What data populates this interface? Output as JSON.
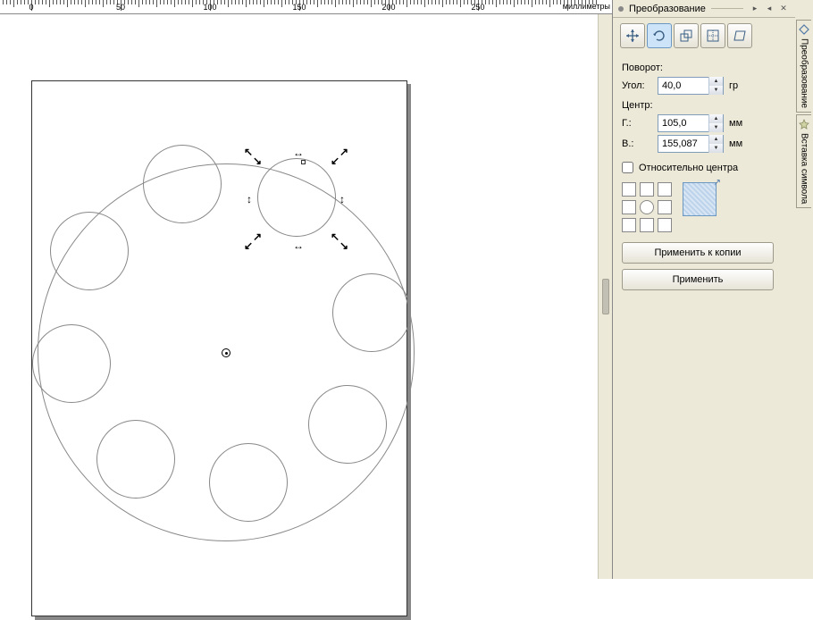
{
  "ruler": {
    "unit_label": "миллиметры",
    "ticks": [
      0,
      50,
      100,
      150,
      200,
      250
    ]
  },
  "panel": {
    "title": "Преобразование",
    "tabs_vertical": [
      {
        "label": "Преобразование",
        "active": true
      },
      {
        "label": "Вставка символа",
        "active": false
      }
    ],
    "transform_tabs": [
      "position",
      "rotate",
      "scale",
      "size",
      "skew"
    ],
    "active_transform_tab": "rotate",
    "rotation": {
      "label": "Поворот:",
      "angle": {
        "label": "Угол:",
        "value": "40,0",
        "unit": "гр"
      }
    },
    "center": {
      "label": "Центр:",
      "h": {
        "label": "Г.:",
        "value": "105,0",
        "unit": "мм"
      },
      "v": {
        "label": "В.:",
        "value": "155,087",
        "unit": "мм"
      }
    },
    "relative_center": {
      "label": "Относительно центра",
      "checked": false
    },
    "apply_to_copy": "Применить к копии",
    "apply": "Применить"
  }
}
